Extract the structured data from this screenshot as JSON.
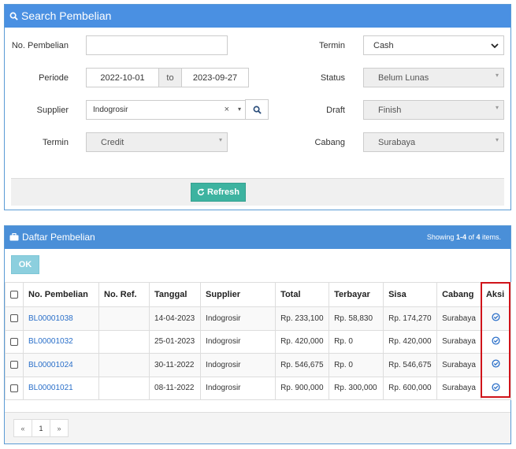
{
  "search": {
    "title": "Search Pembelian",
    "no_pembelian_label": "No. Pembelian",
    "no_pembelian_value": "",
    "periode_label": "Periode",
    "periode_from": "2022-10-01",
    "periode_to_label": "to",
    "periode_to": "2023-09-27",
    "supplier_label": "Supplier",
    "supplier_value": "Indogrosir",
    "supplier_clear": "×",
    "supplier_caret": "▾",
    "termin_left_label": "Termin",
    "termin_left_value": "Credit",
    "termin_right_label": "Termin",
    "termin_right_value": "Cash",
    "status_label": "Status",
    "status_value": "Belum Lunas",
    "draft_label": "Draft",
    "draft_value": "Finish",
    "cabang_label": "Cabang",
    "cabang_value": "Surabaya",
    "refresh_label": "Refresh"
  },
  "list": {
    "title": "Daftar Pembelian",
    "summary_prefix": "Showing ",
    "summary_range": "1-4",
    "summary_mid": " of ",
    "summary_total": "4",
    "summary_suffix": " items.",
    "ok_label": "OK",
    "columns": [
      "No. Pembelian",
      "No. Ref.",
      "Tanggal",
      "Supplier",
      "Total",
      "Terbayar",
      "Sisa",
      "Cabang",
      "Aksi"
    ],
    "rows": [
      {
        "no": "BL00001038",
        "ref": "",
        "tanggal": "14-04-2023",
        "supplier": "Indogrosir",
        "total": "Rp. 233,100",
        "terbayar": "Rp. 58,830",
        "sisa": "Rp. 174,270",
        "cabang": "Surabaya"
      },
      {
        "no": "BL00001032",
        "ref": "",
        "tanggal": "25-01-2023",
        "supplier": "Indogrosir",
        "total": "Rp. 420,000",
        "terbayar": "Rp. 0",
        "sisa": "Rp. 420,000",
        "cabang": "Surabaya"
      },
      {
        "no": "BL00001024",
        "ref": "",
        "tanggal": "30-11-2022",
        "supplier": "Indogrosir",
        "total": "Rp. 546,675",
        "terbayar": "Rp. 0",
        "sisa": "Rp. 546,675",
        "cabang": "Surabaya"
      },
      {
        "no": "BL00001021",
        "ref": "",
        "tanggal": "08-11-2022",
        "supplier": "Indogrosir",
        "total": "Rp. 900,000",
        "terbayar": "Rp. 300,000",
        "sisa": "Rp. 600,000",
        "cabang": "Surabaya"
      }
    ],
    "pager": {
      "prev": "«",
      "page": "1",
      "next": "»"
    }
  },
  "colors": {
    "header_blue": "#4a90e2",
    "refresh_teal": "#3db3a0",
    "ok_blue": "#8ccfde",
    "link_blue": "#2a6fc9",
    "highlight_red": "#d0141a"
  }
}
